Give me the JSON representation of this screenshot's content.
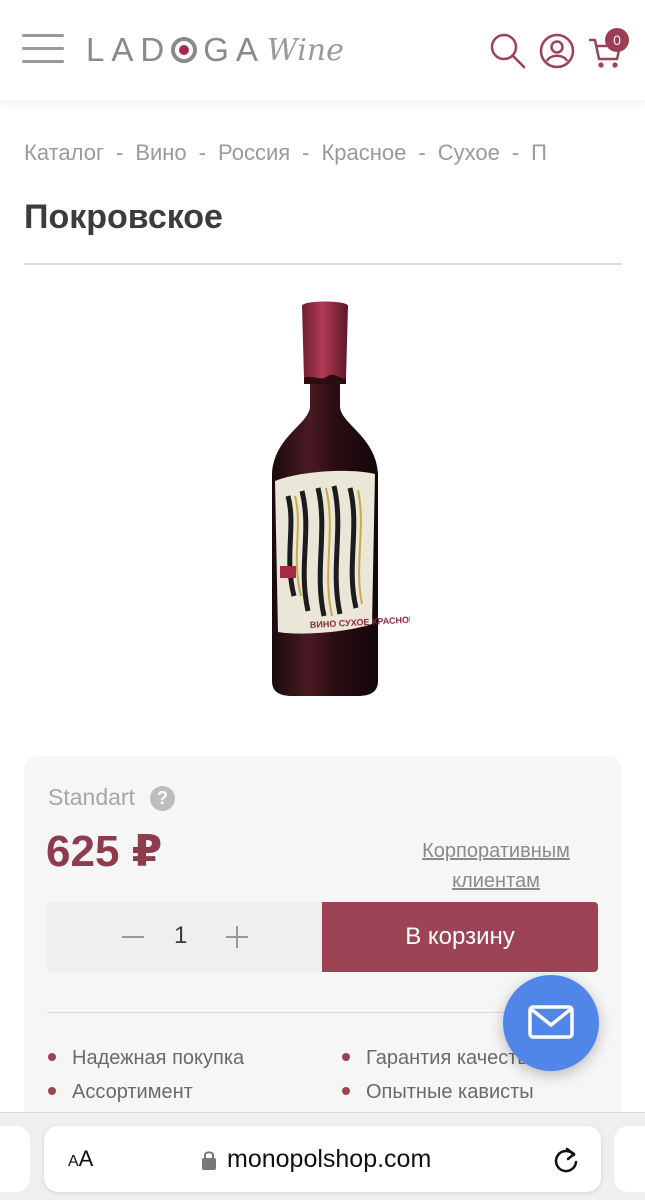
{
  "header": {
    "logo_main": "LAD",
    "logo_rest": "GA",
    "logo_sub": "Wine",
    "cart_count": "0",
    "icons": [
      "menu-icon",
      "search-icon",
      "user-icon",
      "cart-icon"
    ],
    "accent_color": "#9c4455"
  },
  "breadcrumb": {
    "items": [
      "Каталог",
      "Вино",
      "Россия",
      "Красное",
      "Сухое",
      "П"
    ],
    "separator": "-"
  },
  "product": {
    "title": "Покровское",
    "label_text": "ВИНО СУХОЕ КРАСНОЕ"
  },
  "offer": {
    "price_type": "Standart",
    "help_symbol": "?",
    "price": "625 ₽",
    "corporate_link_line1": "Корпоративным",
    "corporate_link_line2": "клиентам",
    "quantity": "1",
    "add_to_cart": "В корзину",
    "features": [
      "Надежная покупка",
      "Гарантия качества",
      "Ассортимент",
      "Опытные кависты"
    ]
  },
  "browser": {
    "text_size_small": "A",
    "text_size_large": "A",
    "url": "monopolshop.com"
  }
}
